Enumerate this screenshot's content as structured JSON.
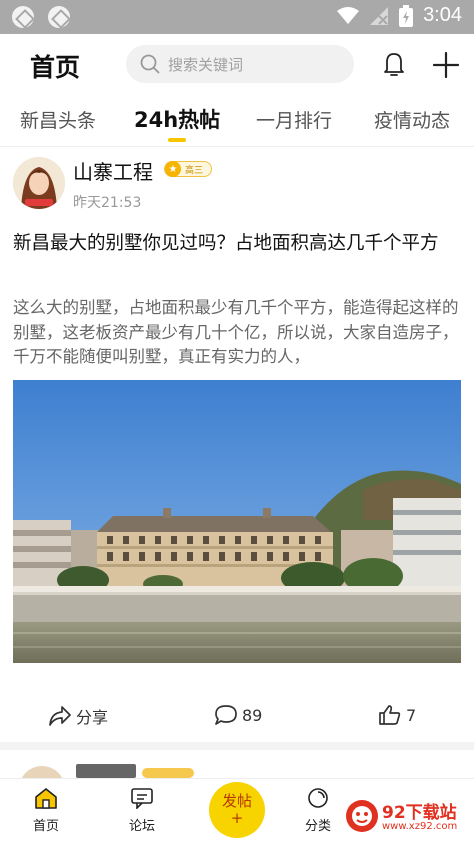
{
  "status_bar": {
    "time": "3:04"
  },
  "header": {
    "title": "首页",
    "search_placeholder": "搜索关键词"
  },
  "tabs": [
    {
      "label": "新昌头条"
    },
    {
      "label": "24h热帖"
    },
    {
      "label": "一月排行"
    },
    {
      "label": "疫情动态"
    }
  ],
  "active_tab": "24h热帖",
  "post": {
    "author": "山寨工程",
    "level_badge": "高三",
    "time": "昨天21:53",
    "title": "新昌最大的别墅你见过吗？占地面积高达几千个平方",
    "excerpt": "这么大的别墅，占地面积最少有几千个平方，能造得起这样的别墅，这老板资产最少有几十个亿，所以说，大家自造房子，千万不能随便叫别墅，真正有实力的人，",
    "share_label": "分享",
    "comment_count": "89",
    "like_count": "7"
  },
  "bottom_nav": {
    "home": "首页",
    "forum": "论坛",
    "post_button": "发帖",
    "post_button_plus": "+",
    "category": "分类"
  },
  "watermark": {
    "name": "92下载站",
    "url": "www.xz92.com"
  },
  "colors": {
    "accent": "#f7c600",
    "fab": "#f7d400",
    "watermark": "#e03020"
  }
}
